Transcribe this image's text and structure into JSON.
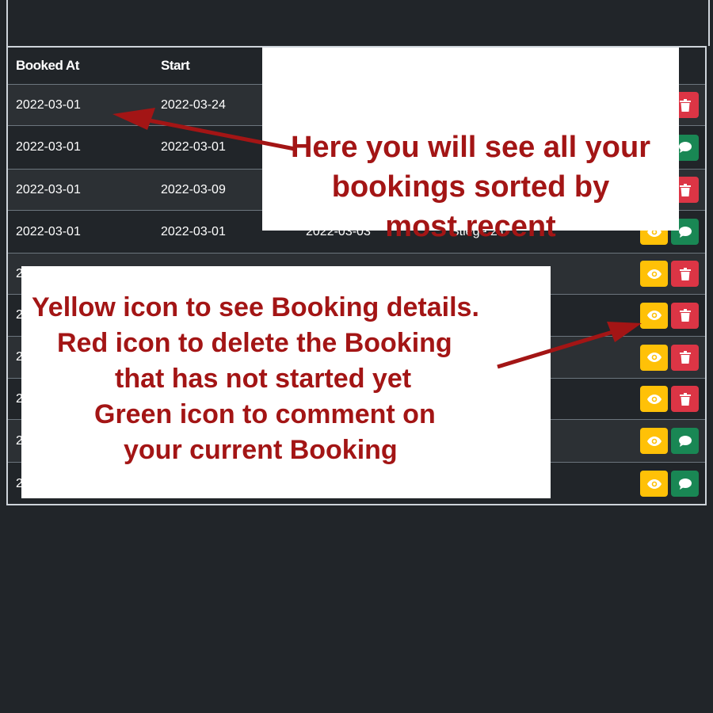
{
  "table": {
    "headers": [
      "Booked At",
      "Start",
      "",
      "",
      ""
    ],
    "rows": [
      {
        "booked_at": "2022-03-01",
        "start": "2022-03-24",
        "end": "",
        "name": "",
        "actions": [
          "view",
          "delete"
        ]
      },
      {
        "booked_at": "2022-03-01",
        "start": "2022-03-01",
        "end": "",
        "name": "",
        "actions": [
          "view",
          "comment"
        ]
      },
      {
        "booked_at": "2022-03-01",
        "start": "2022-03-09",
        "end": "",
        "name": "",
        "actions": [
          "view",
          "delete"
        ]
      },
      {
        "booked_at": "2022-03-01",
        "start": "2022-03-01",
        "end": "2022-03-03",
        "name": "Stiege 2.0",
        "actions": [
          "view",
          "comment"
        ]
      },
      {
        "booked_at": "2",
        "start": "",
        "end": "",
        "name": "",
        "actions": [
          "view",
          "delete"
        ]
      },
      {
        "booked_at": "2",
        "start": "",
        "end": "",
        "name": "",
        "actions": [
          "view",
          "delete"
        ]
      },
      {
        "booked_at": "2",
        "start": "",
        "end": "",
        "name": "",
        "actions": [
          "view",
          "delete"
        ]
      },
      {
        "booked_at": "2",
        "start": "",
        "end": "",
        "name": "",
        "actions": [
          "view",
          "delete"
        ]
      },
      {
        "booked_at": "2",
        "start": "",
        "end": "",
        "name": "",
        "actions": [
          "view",
          "comment"
        ]
      },
      {
        "booked_at": "2",
        "start": "",
        "end": "",
        "name": "",
        "actions": [
          "view",
          "comment"
        ]
      }
    ]
  },
  "callouts": {
    "top": {
      "lines": [
        "Here you will see all your",
        "bookings sorted by",
        "most recent"
      ]
    },
    "bottom": {
      "lines": [
        "Yellow icon to see  Booking details.",
        "Red icon to delete the Booking",
        "that has not started yet",
        "Green icon to comment on",
        "your current Booking"
      ]
    }
  },
  "icons": {
    "view": "eye-icon",
    "delete": "trash-icon",
    "comment": "comment-icon"
  },
  "colors": {
    "view": "#ffc107",
    "delete": "#dc3545",
    "comment": "#198754",
    "annotation_text": "#a31515",
    "arrow": "#a31515"
  }
}
